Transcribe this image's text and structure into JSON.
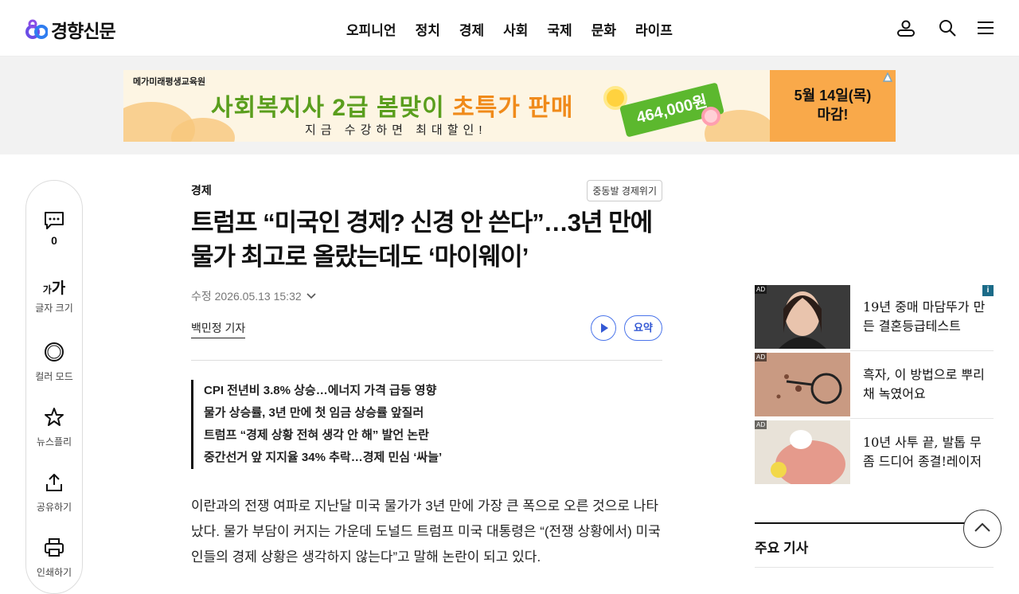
{
  "header": {
    "logo_text": "경향신문",
    "nav": [
      "오피니언",
      "정치",
      "경제",
      "사회",
      "국제",
      "문화",
      "라이프"
    ],
    "icons": [
      "user-icon",
      "search-icon",
      "menu-icon"
    ]
  },
  "banner": {
    "brand": "메가미래평생교육원",
    "headline_main": "사회복지사 2급 봄맞이 ",
    "headline_accent": "초특가 판매",
    "sub": "지금 수강하면 최대할인!",
    "price": "464,000원",
    "deadline_line1": "5월 14일(목)",
    "deadline_line2": "마감!"
  },
  "rail": {
    "comments_count": "0",
    "font_size_glyph_small": "가",
    "font_size_glyph_large": "가",
    "font_size_label": "글자 크기",
    "color_mode_label": "컬러 모드",
    "newsply_label": "뉴스플리",
    "share_label": "공유하기",
    "print_label": "인쇄하기"
  },
  "article": {
    "section": "경제",
    "series_tag": "중동발 경제위기",
    "title": "트럼프 “미국인 경제? 신경 안 쓴다”…3년 만에 물가 최고로 올랐는데도 ‘마이웨이’",
    "dateline": "수정 2026.05.13 15:32",
    "byline": "백민정 기자",
    "summary_button": "요약",
    "highlights": [
      "CPI 전년비 3.8% 상승…에너지 가격 급등 영향",
      "물가 상승률, 3년 만에 첫 임금 상승률 앞질러",
      "트럼프 “경제 상황 전혀 생각 안 해” 발언 논란",
      "중간선거 앞 지지율 34% 추락…경제 민심 ‘싸늘’"
    ],
    "body": "이란과의 전쟁 여파로 지난달 미국 물가가 3년 만에 가장 큰 폭으로 오른 것으로 나타났다. 물가 부담이 커지는 가운데 도널드 트럼프 미국 대통령은 “(전쟁 상황에서) 미국인들의 경제 상황은 생각하지 않는다”고 말해 논란이 되고 있다."
  },
  "ads": {
    "badge": "AD",
    "info": "i",
    "items": [
      {
        "text": "19년 중매 마담뚜가 만든 결혼등급테스트"
      },
      {
        "text": "흑자, 이 방법으로 뿌리채 녹였어요"
      },
      {
        "text": "10년 사투 끝, 발톱 무좀 드디어 종결!레이저"
      }
    ]
  },
  "main_news": {
    "title": "주요 기사"
  }
}
